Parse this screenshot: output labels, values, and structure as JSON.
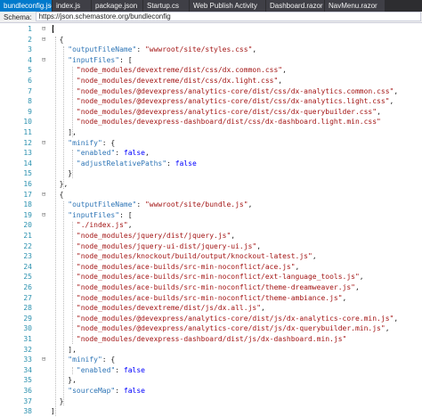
{
  "tabs": [
    {
      "label": "bundleconfig.json",
      "active": true,
      "closable": true
    },
    {
      "label": "index.js",
      "active": false
    },
    {
      "label": "package.json",
      "active": false
    },
    {
      "label": "Startup.cs",
      "active": false
    },
    {
      "label": "Web Publish Activity",
      "active": false
    },
    {
      "label": "Dashboard.razor",
      "active": false
    },
    {
      "label": "NavMenu.razor",
      "active": false
    }
  ],
  "schema": {
    "label": "Schema:",
    "url": "https://json.schemastore.org/bundleconfig"
  },
  "lines": [
    {
      "n": "1",
      "tokens": [
        [
          "p",
          "["
        ]
      ]
    },
    {
      "n": "2",
      "tokens": [
        [
          "p",
          "  {"
        ]
      ]
    },
    {
      "n": "3",
      "tokens": [
        [
          "p",
          "    "
        ],
        [
          "k",
          "\"outputFileName\""
        ],
        [
          "p",
          ": "
        ],
        [
          "s",
          "\"wwwroot/site/styles.css\""
        ],
        [
          "p",
          ","
        ]
      ]
    },
    {
      "n": "4",
      "tokens": [
        [
          "p",
          "    "
        ],
        [
          "k",
          "\"inputFiles\""
        ],
        [
          "p",
          ": ["
        ]
      ]
    },
    {
      "n": "5",
      "tokens": [
        [
          "p",
          "      "
        ],
        [
          "s",
          "\"node_modules/devextreme/dist/css/dx.common.css\""
        ],
        [
          "p",
          ","
        ]
      ]
    },
    {
      "n": "6",
      "tokens": [
        [
          "p",
          "      "
        ],
        [
          "s",
          "\"node_modules/devextreme/dist/css/dx.light.css\""
        ],
        [
          "p",
          ","
        ]
      ]
    },
    {
      "n": "7",
      "tokens": [
        [
          "p",
          "      "
        ],
        [
          "s",
          "\"node_modules/@devexpress/analytics-core/dist/css/dx-analytics.common.css\""
        ],
        [
          "p",
          ","
        ]
      ]
    },
    {
      "n": "8",
      "tokens": [
        [
          "p",
          "      "
        ],
        [
          "s",
          "\"node_modules/@devexpress/analytics-core/dist/css/dx-analytics.light.css\""
        ],
        [
          "p",
          ","
        ]
      ]
    },
    {
      "n": "9",
      "tokens": [
        [
          "p",
          "      "
        ],
        [
          "s",
          "\"node_modules/@devexpress/analytics-core/dist/css/dx-querybuilder.css\""
        ],
        [
          "p",
          ","
        ]
      ]
    },
    {
      "n": "10",
      "tokens": [
        [
          "p",
          "      "
        ],
        [
          "s",
          "\"node_modules/devexpress-dashboard/dist/css/dx-dashboard.light.min.css\""
        ]
      ]
    },
    {
      "n": "11",
      "tokens": [
        [
          "p",
          "    ],"
        ]
      ]
    },
    {
      "n": "12",
      "tokens": [
        [
          "p",
          "    "
        ],
        [
          "k",
          "\"minify\""
        ],
        [
          "p",
          ": {"
        ]
      ]
    },
    {
      "n": "13",
      "tokens": [
        [
          "p",
          "      "
        ],
        [
          "k",
          "\"enabled\""
        ],
        [
          "p",
          ": "
        ],
        [
          "b",
          "false"
        ],
        [
          "p",
          ","
        ]
      ]
    },
    {
      "n": "14",
      "tokens": [
        [
          "p",
          "      "
        ],
        [
          "k",
          "\"adjustRelativePaths\""
        ],
        [
          "p",
          ": "
        ],
        [
          "b",
          "false"
        ]
      ]
    },
    {
      "n": "15",
      "tokens": [
        [
          "p",
          "    }"
        ]
      ]
    },
    {
      "n": "16",
      "tokens": [
        [
          "p",
          "  },"
        ]
      ]
    },
    {
      "n": "17",
      "tokens": [
        [
          "p",
          "  {"
        ]
      ]
    },
    {
      "n": "18",
      "tokens": [
        [
          "p",
          "    "
        ],
        [
          "k",
          "\"outputFileName\""
        ],
        [
          "p",
          ": "
        ],
        [
          "s",
          "\"wwwroot/site/bundle.js\""
        ],
        [
          "p",
          ","
        ]
      ]
    },
    {
      "n": "19",
      "tokens": [
        [
          "p",
          "    "
        ],
        [
          "k",
          "\"inputFiles\""
        ],
        [
          "p",
          ": ["
        ]
      ]
    },
    {
      "n": "20",
      "tokens": [
        [
          "p",
          "      "
        ],
        [
          "s",
          "\"./index.js\""
        ],
        [
          "p",
          ","
        ]
      ]
    },
    {
      "n": "21",
      "tokens": [
        [
          "p",
          "      "
        ],
        [
          "s",
          "\"node_modules/jquery/dist/jquery.js\""
        ],
        [
          "p",
          ","
        ]
      ]
    },
    {
      "n": "22",
      "tokens": [
        [
          "p",
          "      "
        ],
        [
          "s",
          "\"node_modules/jquery-ui-dist/jquery-ui.js\""
        ],
        [
          "p",
          ","
        ]
      ]
    },
    {
      "n": "23",
      "tokens": [
        [
          "p",
          "      "
        ],
        [
          "s",
          "\"node_modules/knockout/build/output/knockout-latest.js\""
        ],
        [
          "p",
          ","
        ]
      ]
    },
    {
      "n": "24",
      "tokens": [
        [
          "p",
          "      "
        ],
        [
          "s",
          "\"node_modules/ace-builds/src-min-noconflict/ace.js\""
        ],
        [
          "p",
          ","
        ]
      ]
    },
    {
      "n": "25",
      "tokens": [
        [
          "p",
          "      "
        ],
        [
          "s",
          "\"node_modules/ace-builds/src-min-noconflict/ext-language_tools.js\""
        ],
        [
          "p",
          ","
        ]
      ]
    },
    {
      "n": "26",
      "tokens": [
        [
          "p",
          "      "
        ],
        [
          "s",
          "\"node_modules/ace-builds/src-min-noconflict/theme-dreamweaver.js\""
        ],
        [
          "p",
          ","
        ]
      ]
    },
    {
      "n": "27",
      "tokens": [
        [
          "p",
          "      "
        ],
        [
          "s",
          "\"node_modules/ace-builds/src-min-noconflict/theme-ambiance.js\""
        ],
        [
          "p",
          ","
        ]
      ]
    },
    {
      "n": "28",
      "tokens": [
        [
          "p",
          "      "
        ],
        [
          "s",
          "\"node_modules/devextreme/dist/js/dx.all.js\""
        ],
        [
          "p",
          ","
        ]
      ]
    },
    {
      "n": "29",
      "tokens": [
        [
          "p",
          "      "
        ],
        [
          "s",
          "\"node_modules/@devexpress/analytics-core/dist/js/dx-analytics-core.min.js\""
        ],
        [
          "p",
          ","
        ]
      ]
    },
    {
      "n": "30",
      "tokens": [
        [
          "p",
          "      "
        ],
        [
          "s",
          "\"node_modules/@devexpress/analytics-core/dist/js/dx-querybuilder.min.js\""
        ],
        [
          "p",
          ","
        ]
      ]
    },
    {
      "n": "31",
      "tokens": [
        [
          "p",
          "      "
        ],
        [
          "s",
          "\"node_modules/devexpress-dashboard/dist/js/dx-dashboard.min.js\""
        ]
      ]
    },
    {
      "n": "32",
      "tokens": [
        [
          "p",
          "    ],"
        ]
      ]
    },
    {
      "n": "33",
      "tokens": [
        [
          "p",
          "    "
        ],
        [
          "k",
          "\"minify\""
        ],
        [
          "p",
          ": {"
        ]
      ]
    },
    {
      "n": "34",
      "tokens": [
        [
          "p",
          "      "
        ],
        [
          "k",
          "\"enabled\""
        ],
        [
          "p",
          ": "
        ],
        [
          "b",
          "false"
        ]
      ]
    },
    {
      "n": "35",
      "tokens": [
        [
          "p",
          "    },"
        ]
      ]
    },
    {
      "n": "36",
      "tokens": [
        [
          "p",
          "    "
        ],
        [
          "k",
          "\"sourceMap\""
        ],
        [
          "p",
          ": "
        ],
        [
          "b",
          "false"
        ]
      ]
    },
    {
      "n": "37",
      "tokens": [
        [
          "p",
          "  }"
        ]
      ]
    },
    {
      "n": "38",
      "tokens": [
        [
          "p",
          "]"
        ]
      ]
    }
  ],
  "folds": [
    "1",
    "2",
    "4",
    "12",
    "17",
    "19",
    "33"
  ],
  "colors": {
    "tab_active": "#007acc",
    "tabbar": "#2d2d30",
    "key": "#2e75b6",
    "string": "#a31515",
    "keyword": "#0000ff",
    "line_number": "#2b91af"
  }
}
